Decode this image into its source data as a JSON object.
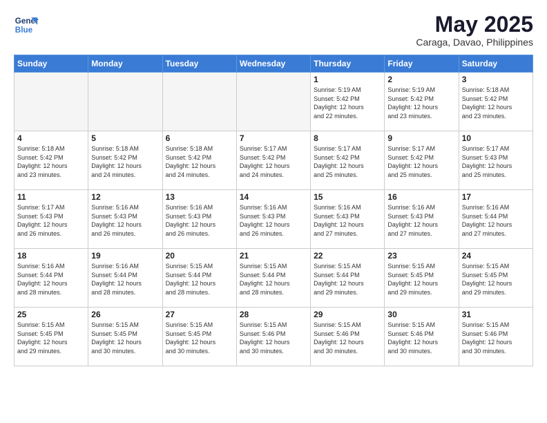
{
  "header": {
    "logo_line1": "General",
    "logo_line2": "Blue",
    "month": "May 2025",
    "location": "Caraga, Davao, Philippines"
  },
  "weekdays": [
    "Sunday",
    "Monday",
    "Tuesday",
    "Wednesday",
    "Thursday",
    "Friday",
    "Saturday"
  ],
  "weeks": [
    [
      {
        "day": "",
        "info": ""
      },
      {
        "day": "",
        "info": ""
      },
      {
        "day": "",
        "info": ""
      },
      {
        "day": "",
        "info": ""
      },
      {
        "day": "1",
        "info": "Sunrise: 5:19 AM\nSunset: 5:42 PM\nDaylight: 12 hours\nand 22 minutes."
      },
      {
        "day": "2",
        "info": "Sunrise: 5:19 AM\nSunset: 5:42 PM\nDaylight: 12 hours\nand 23 minutes."
      },
      {
        "day": "3",
        "info": "Sunrise: 5:18 AM\nSunset: 5:42 PM\nDaylight: 12 hours\nand 23 minutes."
      }
    ],
    [
      {
        "day": "4",
        "info": "Sunrise: 5:18 AM\nSunset: 5:42 PM\nDaylight: 12 hours\nand 23 minutes."
      },
      {
        "day": "5",
        "info": "Sunrise: 5:18 AM\nSunset: 5:42 PM\nDaylight: 12 hours\nand 24 minutes."
      },
      {
        "day": "6",
        "info": "Sunrise: 5:18 AM\nSunset: 5:42 PM\nDaylight: 12 hours\nand 24 minutes."
      },
      {
        "day": "7",
        "info": "Sunrise: 5:17 AM\nSunset: 5:42 PM\nDaylight: 12 hours\nand 24 minutes."
      },
      {
        "day": "8",
        "info": "Sunrise: 5:17 AM\nSunset: 5:42 PM\nDaylight: 12 hours\nand 25 minutes."
      },
      {
        "day": "9",
        "info": "Sunrise: 5:17 AM\nSunset: 5:42 PM\nDaylight: 12 hours\nand 25 minutes."
      },
      {
        "day": "10",
        "info": "Sunrise: 5:17 AM\nSunset: 5:43 PM\nDaylight: 12 hours\nand 25 minutes."
      }
    ],
    [
      {
        "day": "11",
        "info": "Sunrise: 5:17 AM\nSunset: 5:43 PM\nDaylight: 12 hours\nand 26 minutes."
      },
      {
        "day": "12",
        "info": "Sunrise: 5:16 AM\nSunset: 5:43 PM\nDaylight: 12 hours\nand 26 minutes."
      },
      {
        "day": "13",
        "info": "Sunrise: 5:16 AM\nSunset: 5:43 PM\nDaylight: 12 hours\nand 26 minutes."
      },
      {
        "day": "14",
        "info": "Sunrise: 5:16 AM\nSunset: 5:43 PM\nDaylight: 12 hours\nand 26 minutes."
      },
      {
        "day": "15",
        "info": "Sunrise: 5:16 AM\nSunset: 5:43 PM\nDaylight: 12 hours\nand 27 minutes."
      },
      {
        "day": "16",
        "info": "Sunrise: 5:16 AM\nSunset: 5:43 PM\nDaylight: 12 hours\nand 27 minutes."
      },
      {
        "day": "17",
        "info": "Sunrise: 5:16 AM\nSunset: 5:44 PM\nDaylight: 12 hours\nand 27 minutes."
      }
    ],
    [
      {
        "day": "18",
        "info": "Sunrise: 5:16 AM\nSunset: 5:44 PM\nDaylight: 12 hours\nand 28 minutes."
      },
      {
        "day": "19",
        "info": "Sunrise: 5:16 AM\nSunset: 5:44 PM\nDaylight: 12 hours\nand 28 minutes."
      },
      {
        "day": "20",
        "info": "Sunrise: 5:15 AM\nSunset: 5:44 PM\nDaylight: 12 hours\nand 28 minutes."
      },
      {
        "day": "21",
        "info": "Sunrise: 5:15 AM\nSunset: 5:44 PM\nDaylight: 12 hours\nand 28 minutes."
      },
      {
        "day": "22",
        "info": "Sunrise: 5:15 AM\nSunset: 5:44 PM\nDaylight: 12 hours\nand 29 minutes."
      },
      {
        "day": "23",
        "info": "Sunrise: 5:15 AM\nSunset: 5:45 PM\nDaylight: 12 hours\nand 29 minutes."
      },
      {
        "day": "24",
        "info": "Sunrise: 5:15 AM\nSunset: 5:45 PM\nDaylight: 12 hours\nand 29 minutes."
      }
    ],
    [
      {
        "day": "25",
        "info": "Sunrise: 5:15 AM\nSunset: 5:45 PM\nDaylight: 12 hours\nand 29 minutes."
      },
      {
        "day": "26",
        "info": "Sunrise: 5:15 AM\nSunset: 5:45 PM\nDaylight: 12 hours\nand 30 minutes."
      },
      {
        "day": "27",
        "info": "Sunrise: 5:15 AM\nSunset: 5:45 PM\nDaylight: 12 hours\nand 30 minutes."
      },
      {
        "day": "28",
        "info": "Sunrise: 5:15 AM\nSunset: 5:46 PM\nDaylight: 12 hours\nand 30 minutes."
      },
      {
        "day": "29",
        "info": "Sunrise: 5:15 AM\nSunset: 5:46 PM\nDaylight: 12 hours\nand 30 minutes."
      },
      {
        "day": "30",
        "info": "Sunrise: 5:15 AM\nSunset: 5:46 PM\nDaylight: 12 hours\nand 30 minutes."
      },
      {
        "day": "31",
        "info": "Sunrise: 5:15 AM\nSunset: 5:46 PM\nDaylight: 12 hours\nand 30 minutes."
      }
    ]
  ]
}
